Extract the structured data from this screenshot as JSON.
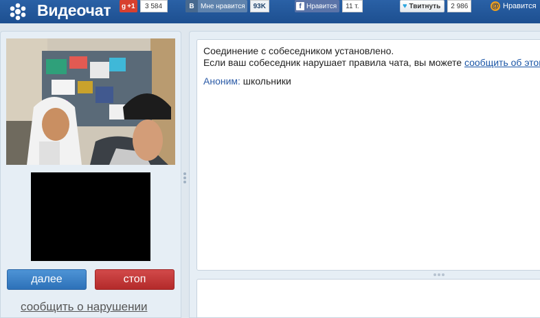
{
  "header": {
    "logo_text": "Видеочат",
    "logo_icon": "dots-flower-icon",
    "share": {
      "gplus_label": "+1",
      "gplus_count": "3 584",
      "vk_badge": "В",
      "vk_label": "Мне нравится",
      "vk_count": "93K",
      "fb_badge": "f",
      "fb_label": "Нравится",
      "fb_count": "11 т.",
      "tw_label": "Твитнуть",
      "tw_count": "2 986",
      "mr_label": "Нравится"
    }
  },
  "left": {
    "next_label": "далее",
    "stop_label": "стоп",
    "report_label": "сообщить о нарушении"
  },
  "chat": {
    "system_line1": "Соединение с собеседником установлено.",
    "system_line2": "Если ваш собеседник нарушает правила чата, вы можете ",
    "system_link": "сообщить об этом",
    "messages": [
      {
        "author": "Аноним:",
        "text": " школьники"
      }
    ]
  },
  "colors": {
    "header": "#1d4f90",
    "next_button": "#2d71b8",
    "stop_button": "#b32a2a",
    "author": "#2a5aa6"
  }
}
